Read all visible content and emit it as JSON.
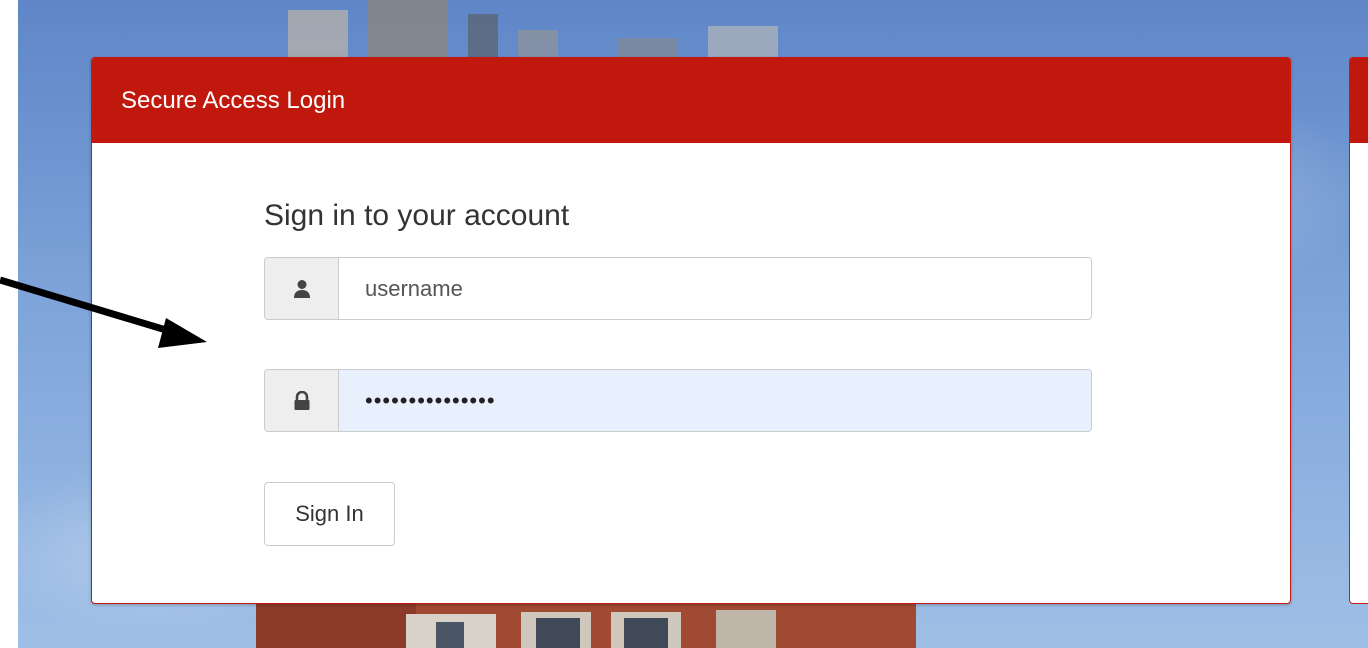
{
  "panel": {
    "heading": "Secure Access Login",
    "title": "Sign in to your account"
  },
  "username": {
    "icon": "user-icon",
    "placeholder": "username",
    "value": ""
  },
  "password": {
    "icon": "lock-icon",
    "value": "•••••••••••••••"
  },
  "signin_button": {
    "label": "Sign In"
  },
  "colors": {
    "header_red": "#c0180d",
    "border_red": "#c51911",
    "autofill_blue": "#e8f0fe",
    "addon_gray": "#eeeeee"
  }
}
